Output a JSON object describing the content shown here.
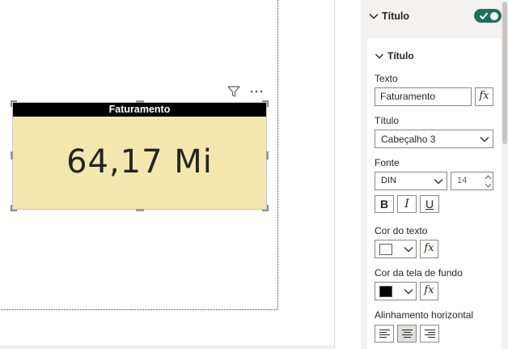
{
  "visual": {
    "card_title": "Faturamento",
    "card_value": "64,17 Mi"
  },
  "pane": {
    "section_title": "Título",
    "section_toggle_on": true,
    "subsection_title": "Título",
    "texto_label": "Texto",
    "texto_value": "Faturamento",
    "fx_label": "fx",
    "titulo_label": "Título",
    "titulo_value": "Cabeçalho 3",
    "fonte_label": "Fonte",
    "font_family_value": "DIN",
    "font_size_value": "14",
    "bold_label": "B",
    "italic_label": "I",
    "underline_label": "U",
    "cor_texto_label": "Cor do texto",
    "cor_texto_color": "#ffffff",
    "cor_fundo_label": "Cor da tela de fundo",
    "cor_fundo_color": "#000000",
    "alinhamento_label": "Alinhamento horizontal",
    "alinhamento_selected": "center"
  },
  "colors": {
    "card_background": "#f3e7ae",
    "title_bar": "#000000",
    "toggle_on": "#1f6f5b"
  },
  "icons": {
    "filter": "filter-icon",
    "more": "more-options-icon",
    "chevron": "chevron-down-icon",
    "check": "check-icon"
  }
}
